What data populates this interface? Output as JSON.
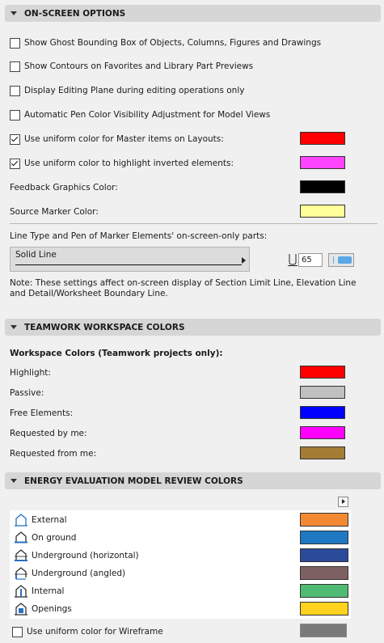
{
  "onscreen": {
    "title": "ON-SCREEN OPTIONS",
    "options": [
      {
        "label": "Show Ghost Bounding Box of Objects, Columns, Figures and Drawings",
        "checked": false
      },
      {
        "label": "Show Contours on Favorites and Library Part Previews",
        "checked": false
      },
      {
        "label": "Display Editing Plane during editing operations only",
        "checked": false
      },
      {
        "label": "Automatic Pen Color Visibility Adjustment for Model Views",
        "checked": false
      },
      {
        "label": "Use uniform color for Master items on Layouts:",
        "checked": true,
        "color": "#ff0000"
      },
      {
        "label": "Use uniform color to highlight inverted elements:",
        "checked": true,
        "color": "#ff44ff"
      }
    ],
    "feedback_label": "Feedback Graphics Color:",
    "feedback_color": "#000000",
    "source_label": "Source Marker Color:",
    "source_color": "#ffff99",
    "line_type_heading": "Line Type and Pen of Marker Elements' on-screen-only parts:",
    "line_type_value": "Solid Line",
    "pen_number": "65",
    "note": "Note: These settings affect on-screen display of Section Limit Line, Elevation Line and Detail/Worksheet Boundary Line."
  },
  "teamwork": {
    "title": "TEAMWORK WORKSPACE COLORS",
    "subheading": "Workspace Colors (Teamwork projects only):",
    "items": [
      {
        "label": "Highlight:",
        "color": "#ff0000"
      },
      {
        "label": "Passive:",
        "color": "#c0c0c0"
      },
      {
        "label": "Free Elements:",
        "color": "#0000ff"
      },
      {
        "label": "Requested by me:",
        "color": "#ff00ff"
      },
      {
        "label": "Requested from me:",
        "color": "#a47c34"
      }
    ]
  },
  "energy": {
    "title": "ENERGY EVALUATION MODEL REVIEW COLORS",
    "items": [
      {
        "label": "External",
        "color": "#f38a33",
        "icon": "external-structure-icon"
      },
      {
        "label": "On ground",
        "color": "#1e78c2",
        "icon": "on-ground-structure-icon"
      },
      {
        "label": "Underground (horizontal)",
        "color": "#2c4a9a",
        "icon": "underground-horizontal-icon"
      },
      {
        "label": "Underground (angled)",
        "color": "#7d6161",
        "icon": "underground-angled-icon"
      },
      {
        "label": "Internal",
        "color": "#4fba72",
        "icon": "internal-structure-icon"
      },
      {
        "label": "Openings",
        "color": "#ffd21e",
        "icon": "openings-icon"
      }
    ],
    "wireframe_label": "Use uniform color for Wireframe",
    "wireframe_checked": false,
    "wireframe_color": "#7a7a7a"
  }
}
